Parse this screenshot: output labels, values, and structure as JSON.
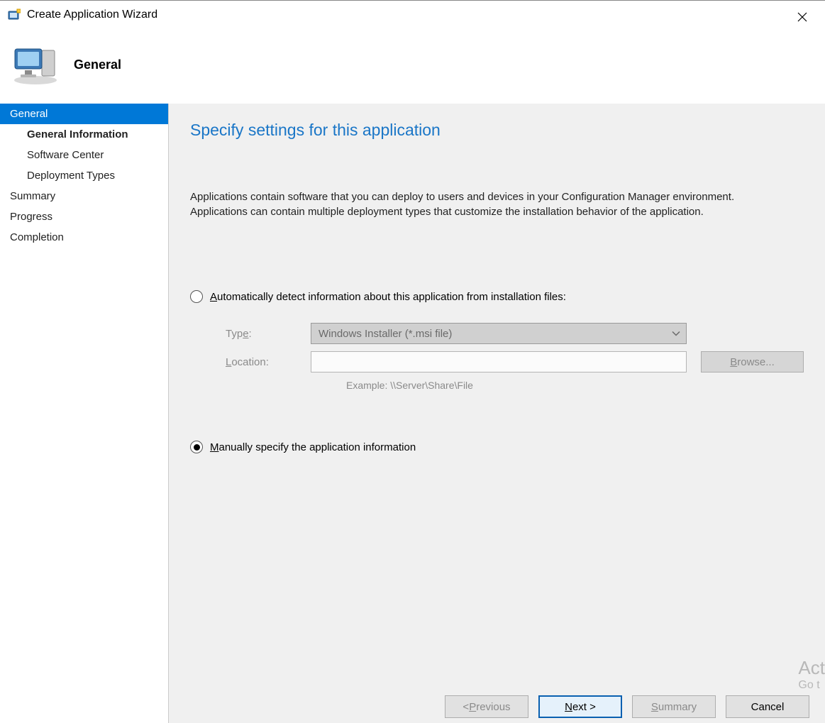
{
  "window": {
    "title": "Create Application Wizard"
  },
  "header": {
    "label": "General"
  },
  "sidebar": {
    "items": [
      {
        "label": "General",
        "type": "top",
        "active": true
      },
      {
        "label": "General Information",
        "type": "sub",
        "bold": true
      },
      {
        "label": "Software Center",
        "type": "sub"
      },
      {
        "label": "Deployment Types",
        "type": "sub"
      },
      {
        "label": "Summary",
        "type": "top"
      },
      {
        "label": "Progress",
        "type": "top"
      },
      {
        "label": "Completion",
        "type": "top"
      }
    ]
  },
  "main": {
    "title": "Specify settings for this application",
    "description": "Applications contain software that you can deploy to users and devices in your Configuration Manager environment. Applications can contain multiple deployment types that customize the installation behavior of the application.",
    "radio_auto": {
      "prefix": "",
      "mn": "A",
      "rest": "utomatically detect information about this application from installation files:",
      "selected": false
    },
    "form": {
      "type_label_pre": "Typ",
      "type_label_mn": "e",
      "type_label_post": ":",
      "type_value": "Windows Installer (*.msi file)",
      "location_label_mn": "L",
      "location_label_rest": "ocation:",
      "location_value": "",
      "example": "Example: \\\\Server\\Share\\File",
      "browse_pre": "",
      "browse_mn": "B",
      "browse_rest": "rowse..."
    },
    "radio_manual": {
      "mn": "M",
      "rest": "anually specify the application information",
      "selected": true
    }
  },
  "watermark": {
    "line1": "Act",
    "line2": "Go t"
  },
  "footer": {
    "previous_pre": "< ",
    "previous_mn": "P",
    "previous_rest": "revious",
    "next_mn": "N",
    "next_rest": "ext >",
    "summary_mn": "S",
    "summary_rest": "ummary",
    "cancel": "Cancel"
  }
}
